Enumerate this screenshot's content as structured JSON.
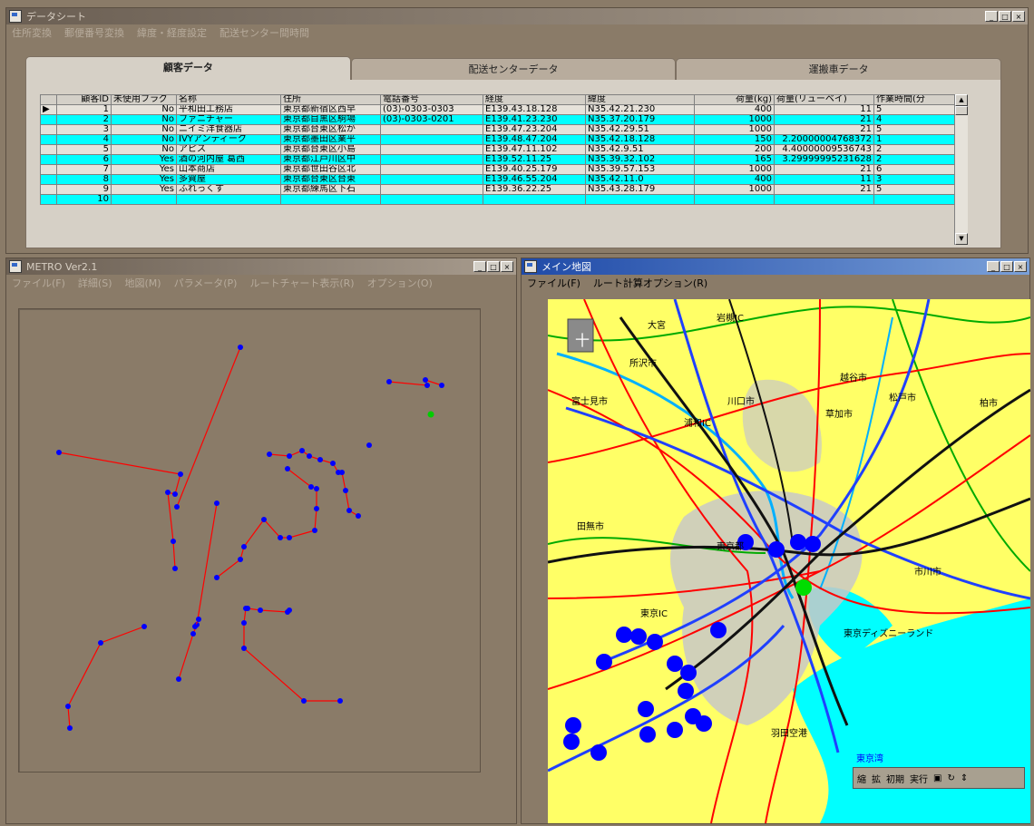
{
  "data_window": {
    "title": "データシート",
    "menu": [
      "住所変換",
      "郵便番号変換",
      "緯度・経度設定",
      "配送センター間時間"
    ],
    "tabs": [
      {
        "label": "顧客データ",
        "active": true
      },
      {
        "label": "配送センターデータ",
        "active": false
      },
      {
        "label": "運搬車データ",
        "active": false
      }
    ],
    "columns": [
      "顧客ID",
      "未使用フラグ",
      "名称",
      "住所",
      "電話番号",
      "経度",
      "緯度",
      "荷量(kg)",
      "荷量(リューベイ)",
      "作業時間(分"
    ],
    "rows": [
      [
        "1",
        "No",
        "平和田工務店",
        "東京都新宿区西早",
        "(03)-0303-0303",
        "E139.43.18.128",
        "N35.42.21.230",
        "400",
        "11",
        "5"
      ],
      [
        "2",
        "No",
        "ファニチャー",
        "東京都目黒区駒場",
        "(03)-0303-0201",
        "E139.41.23.230",
        "N35.37.20.179",
        "1000",
        "21",
        "4"
      ],
      [
        "3",
        "No",
        "ニイミ洋食器店",
        "東京都台東区松が",
        "",
        "E139.47.23.204",
        "N35.42.29.51",
        "1000",
        "21",
        "5"
      ],
      [
        "4",
        "No",
        "IVYアンティーク",
        "東京都墨田区業平",
        "",
        "E139.48.47.204",
        "N35.42.18.128",
        "150",
        "2.20000004768372",
        "1"
      ],
      [
        "5",
        "No",
        "アピス",
        "東京都台東区小島",
        "",
        "E139.47.11.102",
        "N35.42.9.51",
        "200",
        "4.40000009536743",
        "2"
      ],
      [
        "6",
        "Yes",
        "酒の河内屋 葛西",
        "東京都江戸川区中",
        "",
        "E139.52.11.25",
        "N35.39.32.102",
        "165",
        "3.29999995231628",
        "2"
      ],
      [
        "7",
        "Yes",
        "山本商店",
        "東京都世田谷区北",
        "",
        "E139.40.25.179",
        "N35.39.57.153",
        "1000",
        "21",
        "6"
      ],
      [
        "8",
        "Yes",
        "多賀屋",
        "東京都台東区台東",
        "",
        "E139.46.55.204",
        "N35.42.11.0",
        "400",
        "11",
        "3"
      ],
      [
        "9",
        "Yes",
        "ふれっくす",
        "東京都練馬区下石",
        "",
        "E139.36.22.25",
        "N35.43.28.179",
        "1000",
        "21",
        "5"
      ]
    ],
    "partial_row_id": "10"
  },
  "route_window": {
    "title": "METRO Ver2.1",
    "menu": [
      "ファイル(F)",
      "詳細(S)",
      "地図(M)",
      "パラメータ(P)",
      "ルートチャート表示(R)",
      "オプション(O)"
    ]
  },
  "map_window": {
    "title": "メイン地図",
    "menu": [
      "ファイル(F)",
      "ルート計算オプション(R)"
    ],
    "labels": [
      "大宮",
      "岩槻IC",
      "越谷市",
      "草加市",
      "所沢市",
      "富士見市",
      "川口市",
      "浦和IC",
      "東京都",
      "市川市",
      "田無市",
      "東京ディズニーランド",
      "東京IC",
      "東京湾",
      "羽田空港",
      "柏市",
      "松戸市"
    ],
    "toolbar": [
      "縮",
      "拡",
      "初期",
      "実行"
    ],
    "compass": "十"
  },
  "colors": {
    "desktop": "#8a7b68",
    "grid_odd": "#e6e2da",
    "grid_even": "#00ffff",
    "route_line": "#ff0000",
    "customer_node": "#0000ff",
    "depot_node": "#00cc00",
    "map_land": "#ffff66",
    "map_water": "#00ffff",
    "map_urban": "#c8c8c8"
  }
}
